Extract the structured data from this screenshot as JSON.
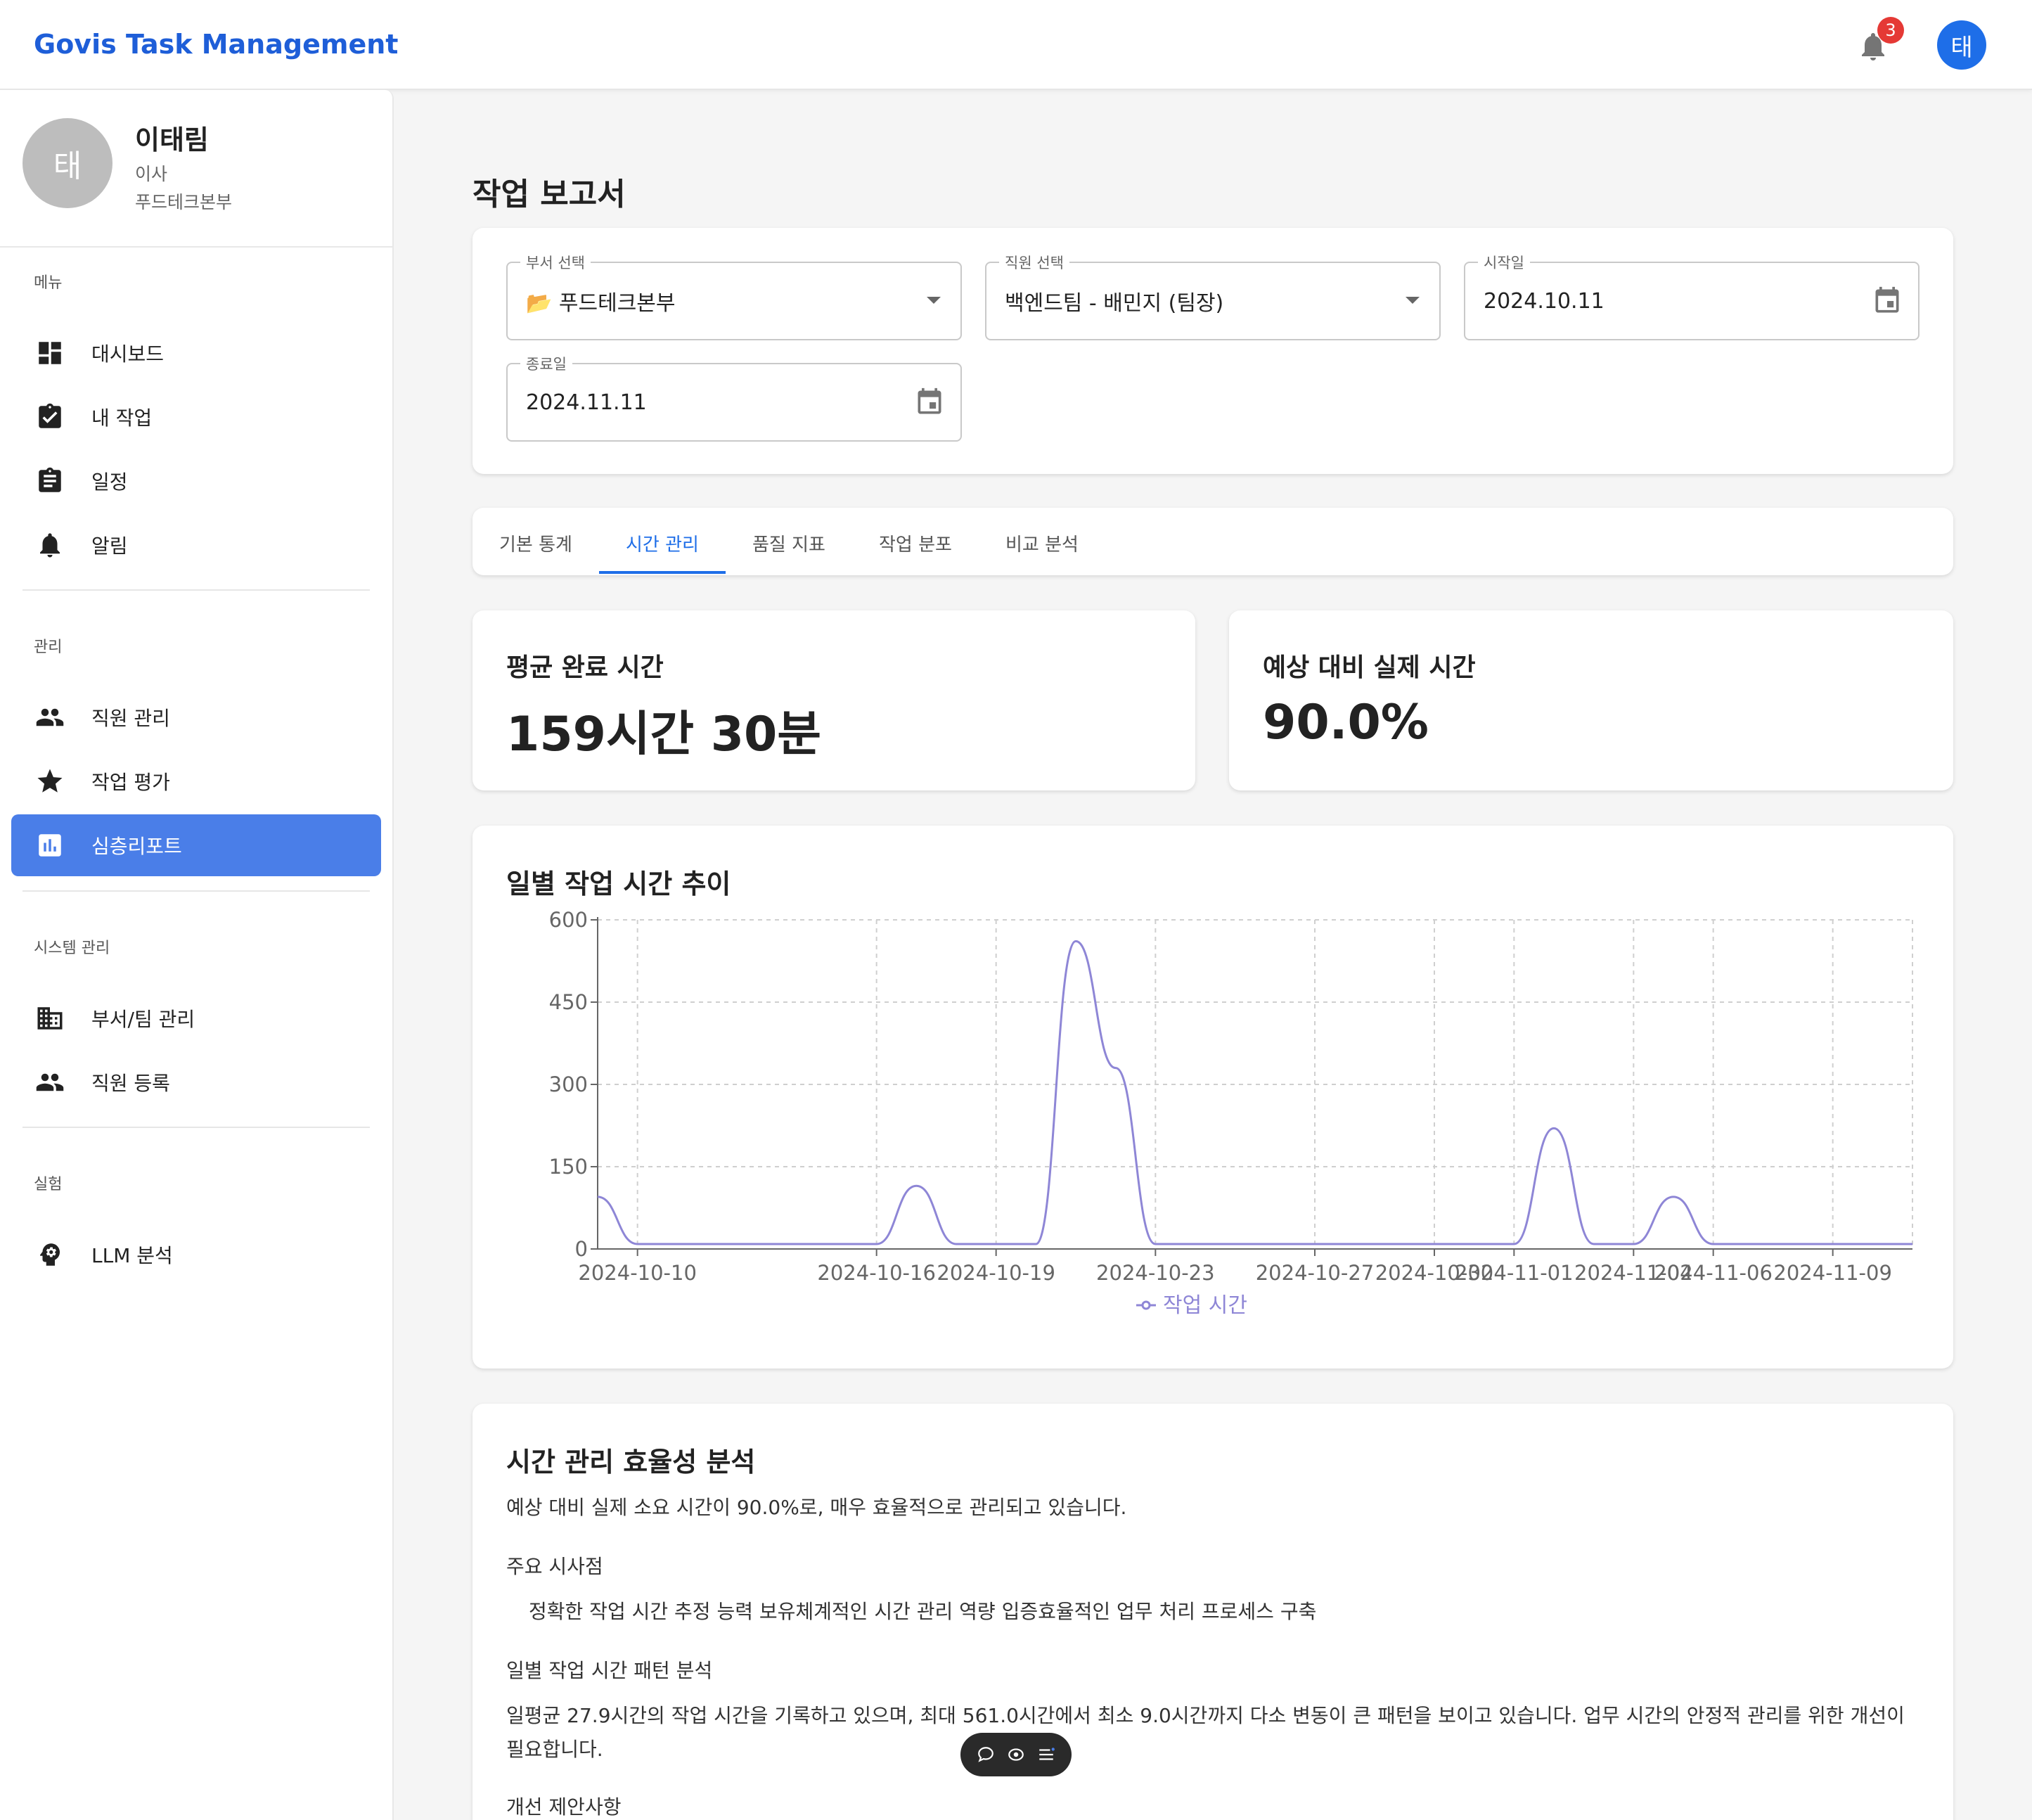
{
  "app": {
    "title": "Govis Task Management",
    "notification_count": "3",
    "user_initial": "태"
  },
  "profile": {
    "initial": "태",
    "name": "이태림",
    "role": "이사",
    "department": "푸드테크본부"
  },
  "sidebar": {
    "sections": [
      {
        "label": "메뉴",
        "items": [
          {
            "label": "대시보드",
            "icon": "dashboard-icon"
          },
          {
            "label": "내 작업",
            "icon": "task-check-icon"
          },
          {
            "label": "일정",
            "icon": "clipboard-icon"
          },
          {
            "label": "알림",
            "icon": "bell-icon"
          }
        ]
      },
      {
        "label": "관리",
        "items": [
          {
            "label": "직원 관리",
            "icon": "people-icon"
          },
          {
            "label": "작업 평가",
            "icon": "star-icon"
          },
          {
            "label": "심층리포트",
            "icon": "bar-chart-icon",
            "active": true
          }
        ]
      },
      {
        "label": "시스템 관리",
        "items": [
          {
            "label": "부서/팀 관리",
            "icon": "building-icon"
          },
          {
            "label": "직원 등록",
            "icon": "people-icon"
          }
        ]
      },
      {
        "label": "실험",
        "items": [
          {
            "label": "LLM 분석",
            "icon": "brain-icon"
          }
        ]
      }
    ]
  },
  "page": {
    "title": "작업 보고서"
  },
  "filters": {
    "department": {
      "label": "부서 선택",
      "value": "📂 푸드테크본부"
    },
    "employee": {
      "label": "직원 선택",
      "value": "백엔드팀 - 배민지 (팀장)"
    },
    "start_date": {
      "label": "시작일",
      "value": "2024.10.11"
    },
    "end_date": {
      "label": "종료일",
      "value": "2024.11.11"
    }
  },
  "tabs": [
    "기본 통계",
    "시간 관리",
    "품질 지표",
    "작업 분포",
    "비교 분석"
  ],
  "active_tab": 1,
  "stats": {
    "avg_completion": {
      "title": "평균 완료 시간",
      "value": "159시간 30분"
    },
    "estimated_vs_actual": {
      "title": "예상 대비 실제 시간",
      "value": "90.0%"
    }
  },
  "chart_title": "일별 작업 시간 추이",
  "chart_data": {
    "type": "line",
    "x": [
      "2024-10-09",
      "2024-10-10",
      "2024-10-11",
      "2024-10-12",
      "2024-10-13",
      "2024-10-14",
      "2024-10-15",
      "2024-10-16",
      "2024-10-17",
      "2024-10-18",
      "2024-10-19",
      "2024-10-20",
      "2024-10-21",
      "2024-10-22",
      "2024-10-23",
      "2024-10-24",
      "2024-10-25",
      "2024-10-26",
      "2024-10-27",
      "2024-10-28",
      "2024-10-29",
      "2024-10-30",
      "2024-10-31",
      "2024-11-01",
      "2024-11-02",
      "2024-11-03",
      "2024-11-04",
      "2024-11-05",
      "2024-11-06",
      "2024-11-07",
      "2024-11-08",
      "2024-11-09",
      "2024-11-10",
      "2024-11-11"
    ],
    "x_tick_labels": [
      "2024-10-10",
      "2024-10-16",
      "2024-10-19",
      "2024-10-23",
      "2024-10-27",
      "2024-10-30",
      "2024-11-01",
      "2024-11-04",
      "2024-11-06",
      "2024-11-09"
    ],
    "series": [
      {
        "name": "작업 시간",
        "values": [
          95,
          9,
          9,
          9,
          9,
          9,
          9,
          9,
          115,
          9,
          9,
          9,
          561,
          330,
          9,
          9,
          9,
          9,
          9,
          9,
          9,
          9,
          9,
          9,
          220,
          9,
          9,
          95,
          9,
          9,
          9,
          9,
          9,
          9
        ]
      }
    ],
    "ylim": [
      0,
      600
    ],
    "yticks": [
      0,
      150,
      300,
      450,
      600
    ],
    "grid": true,
    "legend": "bottom",
    "color": "#8e86d6"
  },
  "analysis": {
    "title": "시간 관리 효율성 분석",
    "summary": "예상 대비 실제 소요 시간이 90.0%로, 매우 효율적으로 관리되고 있습니다.",
    "insights_heading": "주요 시사점",
    "insights": "정확한 작업 시간 추정 능력 보유체계적인 시간 관리 역량 입증효율적인 업무 처리 프로세스 구축",
    "pattern_heading": "일별 작업 시간 패턴 분석",
    "pattern_text": "일평균 27.9시간의 작업 시간을 기록하고 있으며, 최대 561.0시간에서 최소 9.0시간까지 다소 변동이 큰 패턴을 보이고 있습니다. 업무 시간의 안정적 관리를 위한 개선이 필요합니다.",
    "suggestions_heading": "개선 제안사항"
  }
}
